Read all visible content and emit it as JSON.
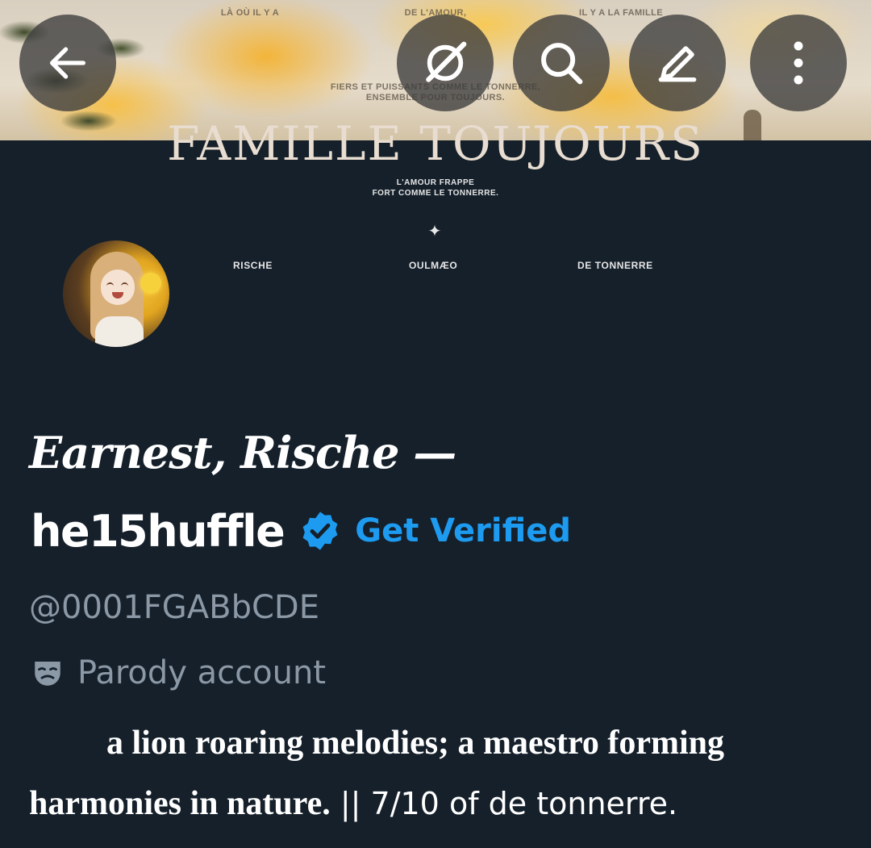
{
  "banner": {
    "text_left": "LÀ OÙ IL Y A",
    "text_center": "DE L'AMOUR,",
    "text_right": "IL Y A LA FAMILLE",
    "tagline_line1": "FIERS ET PUISSANTS COMME LE TONNERRE,",
    "tagline_line2": "ENSEMBLE POUR TOUJOURS."
  },
  "header_buttons": {
    "back": "arrow-left-icon",
    "grok": "grok-icon",
    "search": "search-icon",
    "edit": "edit-pencil-icon",
    "more": "more-vertical-icon"
  },
  "profile_header_art": {
    "title": "FAMILLE TOUJOURS",
    "subtitle_line1": "L'AMOUR FRAPPE",
    "subtitle_line2": "FORT COMME LE TONNERRE.",
    "star": "✦",
    "names": [
      "RISCHE",
      "OULMÆO",
      "DE TONNERRE"
    ]
  },
  "profile": {
    "display_name": "Earnest, Rische —",
    "name_line2": "he15huffle",
    "get_verified": "Get Verified",
    "handle": "@0001FGABbCDE",
    "parody_label": "Parody account",
    "bio_serif_line1": "a lion roaring melodies; a maestro forming",
    "bio_serif_line2": "harmonies in nature.",
    "bio_rest": " || 7/10 of de tonnerre."
  },
  "colors": {
    "background": "#15202b",
    "accent": "#1d9bf0",
    "secondary_text": "#8b98a5"
  }
}
